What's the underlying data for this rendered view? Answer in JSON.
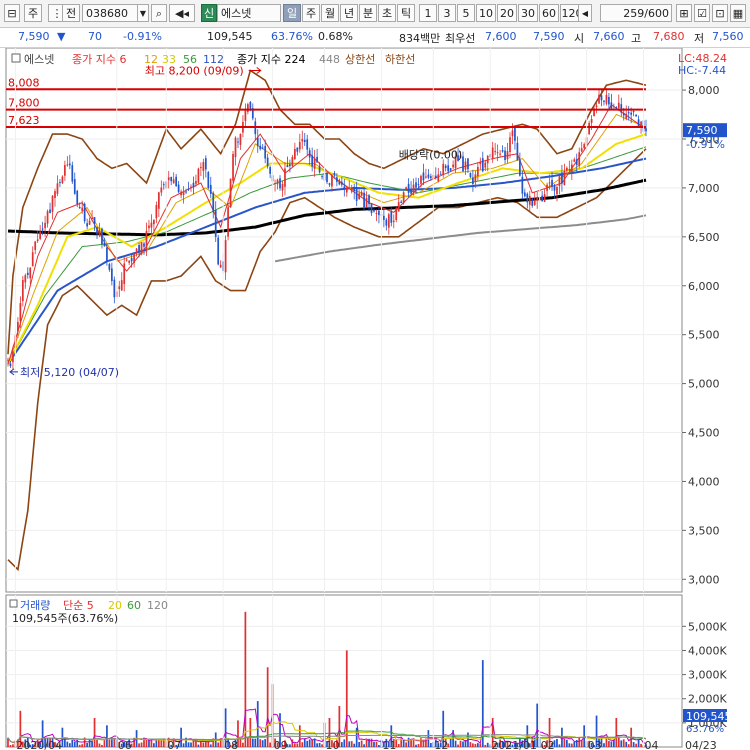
{
  "toolbar": {
    "mode": "주",
    "range": "전",
    "code": "038680",
    "badge": "신",
    "name": "에스넷",
    "periods": [
      "일",
      "주",
      "월",
      "년",
      "분",
      "초",
      "틱"
    ],
    "active_period": "일",
    "numbers": [
      "1",
      "3",
      "5",
      "10",
      "20",
      "30",
      "60",
      "120"
    ],
    "count": "259",
    "count_total": "/600"
  },
  "info": {
    "price": "7,590",
    "change_arrow": "▼",
    "change": "70",
    "change_pct": "-0.91%",
    "volume": "109,545",
    "volume_ratio": "63.76%",
    "turnover_pct": "0.68%",
    "amount": "834백만",
    "best_ask_label": "최우선",
    "best_ask": "7,600",
    "best_bid": "7,590",
    "open_label": "시",
    "open": "7,660",
    "high_label": "고",
    "high": "7,680",
    "low_label": "저",
    "low": "7,560"
  },
  "legend": {
    "name": "에스넷",
    "ma_label": "종가 지수 6",
    "ma12": "12",
    "ma33": "33",
    "ma56": "56",
    "ma112": "112",
    "ma224": "종가 지수 224",
    "ma448": "448",
    "upper": "상한선",
    "lower": "하한선"
  },
  "corner": {
    "lc": "LC:48.24",
    "hc": "HC:-7.44"
  },
  "price_levels": [
    {
      "label": "8,008",
      "value": 8008
    },
    {
      "label": "7,800",
      "value": 7800
    },
    {
      "label": "7,623",
      "value": 7623
    }
  ],
  "annotations": {
    "high": "최고 8,200 (09/09)",
    "low": "최저 5,120 (04/07)",
    "dividend": "배당락(0.00)"
  },
  "current_tag": {
    "price": "7,590",
    "pct": "-0.91%"
  },
  "volume_legend": {
    "title": "거래량",
    "ma_label": "단순 5",
    "ma20": "20",
    "ma60": "60",
    "ma120": "120",
    "value": "109,545주(63.76%)"
  },
  "volume_tag": {
    "value": "109,545",
    "pct": "63.76%"
  },
  "colors": {
    "up": "#e03030",
    "down": "#2255cc",
    "level": "#d80000",
    "bollinger": "#8b4513",
    "ma_yellow": "#f0e000",
    "ma_green": "#3a9a3a",
    "ma_blue": "#2a55c8",
    "ma_black": "#000000",
    "ma_gray": "#8c8c8c"
  },
  "chart_data": {
    "type": "candlestick",
    "y_ticks": [
      3000,
      3500,
      4000,
      4500,
      5000,
      5500,
      6000,
      6500,
      7000,
      7500,
      8000
    ],
    "y_tick_labels": [
      "3,000",
      "3,500",
      "4,000",
      "4,500",
      "5,000",
      "5,500",
      "6,000",
      "6,500",
      "7,000",
      "7,500",
      "8,000"
    ],
    "ylim": [
      2870,
      8430
    ],
    "x_labels": [
      "2020/04",
      "06",
      "07",
      "08",
      "09",
      "10",
      "11",
      "12",
      "2021/01",
      "02",
      "03",
      "04",
      "04/23"
    ],
    "x_label_days": [
      3,
      44,
      64,
      87,
      107,
      128,
      151,
      172,
      195,
      215,
      234,
      257,
      276
    ],
    "n_days": 259,
    "price_anchors": [
      [
        0,
        5200
      ],
      [
        1,
        5150
      ],
      [
        2,
        5300
      ],
      [
        4,
        5700
      ],
      [
        6,
        6000
      ],
      [
        9,
        6200
      ],
      [
        12,
        6500
      ],
      [
        16,
        6700
      ],
      [
        19,
        7000
      ],
      [
        22,
        7150
      ],
      [
        25,
        7200
      ],
      [
        28,
        6900
      ],
      [
        31,
        6700
      ],
      [
        33,
        6650
      ],
      [
        36,
        6600
      ],
      [
        39,
        6400
      ],
      [
        42,
        6000
      ],
      [
        44,
        5900
      ],
      [
        47,
        6200
      ],
      [
        50,
        6300
      ],
      [
        53,
        6400
      ],
      [
        56,
        6500
      ],
      [
        59,
        6700
      ],
      [
        62,
        7000
      ],
      [
        65,
        7100
      ],
      [
        68,
        7000
      ],
      [
        71,
        6900
      ],
      [
        74,
        7000
      ],
      [
        77,
        7200
      ],
      [
        80,
        7200
      ],
      [
        83,
        6800
      ],
      [
        85,
        6200
      ],
      [
        87,
        6100
      ],
      [
        89,
        6800
      ],
      [
        91,
        7400
      ],
      [
        93,
        7500
      ],
      [
        95,
        7700
      ],
      [
        97,
        7800
      ],
      [
        99,
        7700
      ],
      [
        101,
        7400
      ],
      [
        103,
        7400
      ],
      [
        105,
        7200
      ],
      [
        107,
        7100
      ],
      [
        110,
        7000
      ],
      [
        113,
        7200
      ],
      [
        116,
        7400
      ],
      [
        119,
        7500
      ],
      [
        122,
        7300
      ],
      [
        125,
        7200
      ],
      [
        128,
        7100
      ],
      [
        131,
        7100
      ],
      [
        134,
        7000
      ],
      [
        137,
        7000
      ],
      [
        140,
        6900
      ],
      [
        143,
        6900
      ],
      [
        146,
        6800
      ],
      [
        149,
        6750
      ],
      [
        152,
        6700
      ],
      [
        155,
        6650
      ],
      [
        158,
        6800
      ],
      [
        161,
        7000
      ],
      [
        164,
        7000
      ],
      [
        167,
        7100
      ],
      [
        170,
        7100
      ],
      [
        173,
        7150
      ],
      [
        176,
        7200
      ],
      [
        179,
        7200
      ],
      [
        182,
        7300
      ],
      [
        185,
        7200
      ],
      [
        188,
        7050
      ],
      [
        191,
        7200
      ],
      [
        194,
        7300
      ],
      [
        197,
        7400
      ],
      [
        199,
        7350
      ],
      [
        201,
        7300
      ],
      [
        203,
        7500
      ],
      [
        205,
        7550
      ],
      [
        207,
        7100
      ],
      [
        209,
        6900
      ],
      [
        212,
        6850
      ],
      [
        215,
        6900
      ],
      [
        218,
        7000
      ],
      [
        221,
        7000
      ],
      [
        224,
        7100
      ],
      [
        227,
        7200
      ],
      [
        230,
        7300
      ],
      [
        233,
        7500
      ],
      [
        236,
        7700
      ],
      [
        239,
        7900
      ],
      [
        242,
        7900
      ],
      [
        245,
        7800
      ],
      [
        248,
        7800
      ],
      [
        251,
        7750
      ],
      [
        254,
        7700
      ],
      [
        256,
        7650
      ],
      [
        258,
        7590
      ]
    ],
    "ma6_anchors": [
      [
        0,
        5200
      ],
      [
        6,
        5700
      ],
      [
        12,
        6300
      ],
      [
        20,
        6750
      ],
      [
        30,
        6850
      ],
      [
        40,
        6400
      ],
      [
        48,
        6150
      ],
      [
        56,
        6400
      ],
      [
        66,
        6900
      ],
      [
        78,
        7050
      ],
      [
        86,
        6600
      ],
      [
        94,
        7300
      ],
      [
        102,
        7550
      ],
      [
        112,
        7150
      ],
      [
        122,
        7350
      ],
      [
        132,
        7100
      ],
      [
        146,
        6850
      ],
      [
        156,
        6750
      ],
      [
        168,
        7050
      ],
      [
        182,
        7200
      ],
      [
        196,
        7300
      ],
      [
        206,
        7350
      ],
      [
        212,
        6950
      ],
      [
        224,
        7050
      ],
      [
        236,
        7500
      ],
      [
        244,
        7850
      ],
      [
        258,
        7600
      ]
    ],
    "ma12_anchors": [
      [
        0,
        5200
      ],
      [
        10,
        5900
      ],
      [
        20,
        6550
      ],
      [
        32,
        6800
      ],
      [
        44,
        6250
      ],
      [
        56,
        6350
      ],
      [
        68,
        6850
      ],
      [
        80,
        7000
      ],
      [
        90,
        6800
      ],
      [
        100,
        7450
      ],
      [
        112,
        7250
      ],
      [
        124,
        7250
      ],
      [
        138,
        7000
      ],
      [
        152,
        6850
      ],
      [
        166,
        6950
      ],
      [
        180,
        7150
      ],
      [
        196,
        7200
      ],
      [
        208,
        7300
      ],
      [
        218,
        7000
      ],
      [
        232,
        7250
      ],
      [
        246,
        7750
      ],
      [
        258,
        7620
      ]
    ],
    "ma33_anchors": [
      [
        0,
        5200
      ],
      [
        12,
        5800
      ],
      [
        24,
        6500
      ],
      [
        36,
        6600
      ],
      [
        50,
        6400
      ],
      [
        64,
        6600
      ],
      [
        80,
        6850
      ],
      [
        94,
        7050
      ],
      [
        106,
        7250
      ],
      [
        120,
        7250
      ],
      [
        136,
        7100
      ],
      [
        150,
        6950
      ],
      [
        166,
        6900
      ],
      [
        182,
        7050
      ],
      [
        200,
        7200
      ],
      [
        216,
        7150
      ],
      [
        232,
        7200
      ],
      [
        246,
        7450
      ],
      [
        258,
        7550
      ]
    ],
    "ma56_anchors": [
      [
        0,
        5200
      ],
      [
        15,
        5900
      ],
      [
        30,
        6400
      ],
      [
        48,
        6450
      ],
      [
        64,
        6550
      ],
      [
        82,
        6750
      ],
      [
        98,
        6950
      ],
      [
        114,
        7100
      ],
      [
        130,
        7150
      ],
      [
        146,
        7050
      ],
      [
        166,
        6950
      ],
      [
        186,
        7050
      ],
      [
        206,
        7150
      ],
      [
        226,
        7150
      ],
      [
        244,
        7300
      ],
      [
        258,
        7420
      ]
    ],
    "ma112_anchors": [
      [
        0,
        5200
      ],
      [
        20,
        5950
      ],
      [
        40,
        6250
      ],
      [
        60,
        6400
      ],
      [
        80,
        6600
      ],
      [
        100,
        6800
      ],
      [
        120,
        6950
      ],
      [
        140,
        7000
      ],
      [
        160,
        6980
      ],
      [
        180,
        7000
      ],
      [
        200,
        7050
      ],
      [
        220,
        7120
      ],
      [
        240,
        7200
      ],
      [
        258,
        7300
      ]
    ],
    "ma224_anchors": [
      [
        0,
        6560
      ],
      [
        20,
        6540
      ],
      [
        40,
        6530
      ],
      [
        60,
        6520
      ],
      [
        80,
        6540
      ],
      [
        100,
        6600
      ],
      [
        120,
        6720
      ],
      [
        140,
        6780
      ],
      [
        160,
        6800
      ],
      [
        180,
        6820
      ],
      [
        200,
        6860
      ],
      [
        220,
        6900
      ],
      [
        240,
        6980
      ],
      [
        258,
        7080
      ]
    ],
    "ma448_anchors": [
      [
        108,
        6250
      ],
      [
        130,
        6350
      ],
      [
        150,
        6420
      ],
      [
        170,
        6480
      ],
      [
        190,
        6540
      ],
      [
        210,
        6580
      ],
      [
        230,
        6620
      ],
      [
        250,
        6680
      ],
      [
        258,
        6720
      ]
    ],
    "bb_upper_anchors": [
      [
        0,
        5300
      ],
      [
        2,
        6100
      ],
      [
        6,
        6800
      ],
      [
        12,
        7200
      ],
      [
        18,
        7550
      ],
      [
        24,
        7550
      ],
      [
        30,
        7500
      ],
      [
        36,
        7300
      ],
      [
        42,
        7200
      ],
      [
        48,
        7250
      ],
      [
        56,
        7050
      ],
      [
        64,
        7600
      ],
      [
        70,
        7400
      ],
      [
        78,
        7600
      ],
      [
        86,
        7350
      ],
      [
        92,
        7650
      ],
      [
        98,
        8200
      ],
      [
        104,
        8100
      ],
      [
        110,
        7800
      ],
      [
        116,
        7650
      ],
      [
        122,
        7650
      ],
      [
        128,
        7500
      ],
      [
        134,
        7500
      ],
      [
        140,
        7350
      ],
      [
        146,
        7250
      ],
      [
        152,
        7200
      ],
      [
        160,
        7300
      ],
      [
        168,
        7400
      ],
      [
        176,
        7350
      ],
      [
        184,
        7450
      ],
      [
        192,
        7550
      ],
      [
        200,
        7600
      ],
      [
        208,
        7650
      ],
      [
        214,
        7600
      ],
      [
        222,
        7350
      ],
      [
        228,
        7400
      ],
      [
        236,
        7800
      ],
      [
        242,
        8050
      ],
      [
        250,
        8100
      ],
      [
        258,
        8050
      ]
    ],
    "bb_lower_anchors": [
      [
        0,
        3200
      ],
      [
        4,
        3100
      ],
      [
        8,
        3700
      ],
      [
        12,
        4800
      ],
      [
        16,
        5600
      ],
      [
        22,
        5900
      ],
      [
        28,
        6000
      ],
      [
        34,
        5850
      ],
      [
        40,
        5700
      ],
      [
        46,
        5800
      ],
      [
        52,
        5700
      ],
      [
        58,
        6050
      ],
      [
        64,
        6050
      ],
      [
        70,
        6100
      ],
      [
        78,
        6300
      ],
      [
        84,
        6050
      ],
      [
        90,
        5950
      ],
      [
        96,
        5950
      ],
      [
        102,
        6350
      ],
      [
        108,
        6550
      ],
      [
        114,
        6850
      ],
      [
        120,
        6900
      ],
      [
        126,
        6800
      ],
      [
        132,
        6700
      ],
      [
        140,
        6600
      ],
      [
        150,
        6500
      ],
      [
        158,
        6500
      ],
      [
        166,
        6650
      ],
      [
        174,
        6800
      ],
      [
        182,
        6800
      ],
      [
        190,
        6850
      ],
      [
        198,
        6900
      ],
      [
        206,
        6850
      ],
      [
        214,
        6700
      ],
      [
        222,
        6700
      ],
      [
        230,
        6800
      ],
      [
        238,
        6900
      ],
      [
        246,
        7100
      ],
      [
        252,
        7250
      ],
      [
        258,
        7400
      ]
    ],
    "volume": {
      "y_ticks": [
        1000,
        2000,
        3000,
        4000,
        5000
      ],
      "y_tick_labels": [
        "1,000K",
        "2,000K",
        "3,000K",
        "4,000K",
        "5,000K"
      ],
      "ylim": [
        0,
        5800
      ],
      "spikes": [
        [
          5,
          1500
        ],
        [
          14,
          1100
        ],
        [
          22,
          800
        ],
        [
          35,
          1200
        ],
        [
          40,
          900
        ],
        [
          52,
          700
        ],
        [
          70,
          800
        ],
        [
          84,
          600
        ],
        [
          88,
          1600
        ],
        [
          93,
          1100
        ],
        [
          96,
          5600
        ],
        [
          98,
          1200
        ],
        [
          101,
          1900
        ],
        [
          105,
          3300
        ],
        [
          107,
          2600
        ],
        [
          110,
          1400
        ],
        [
          118,
          900
        ],
        [
          128,
          1000
        ],
        [
          130,
          1200
        ],
        [
          134,
          1700
        ],
        [
          137,
          4000
        ],
        [
          141,
          800
        ],
        [
          155,
          900
        ],
        [
          170,
          700
        ],
        [
          176,
          1500
        ],
        [
          180,
          700
        ],
        [
          186,
          600
        ],
        [
          192,
          3600
        ],
        [
          196,
          1200
        ],
        [
          210,
          900
        ],
        [
          214,
          1800
        ],
        [
          219,
          1200
        ],
        [
          224,
          800
        ],
        [
          233,
          900
        ],
        [
          238,
          1300
        ],
        [
          246,
          1200
        ],
        [
          252,
          800
        ],
        [
          258,
          110
        ]
      ]
    }
  }
}
